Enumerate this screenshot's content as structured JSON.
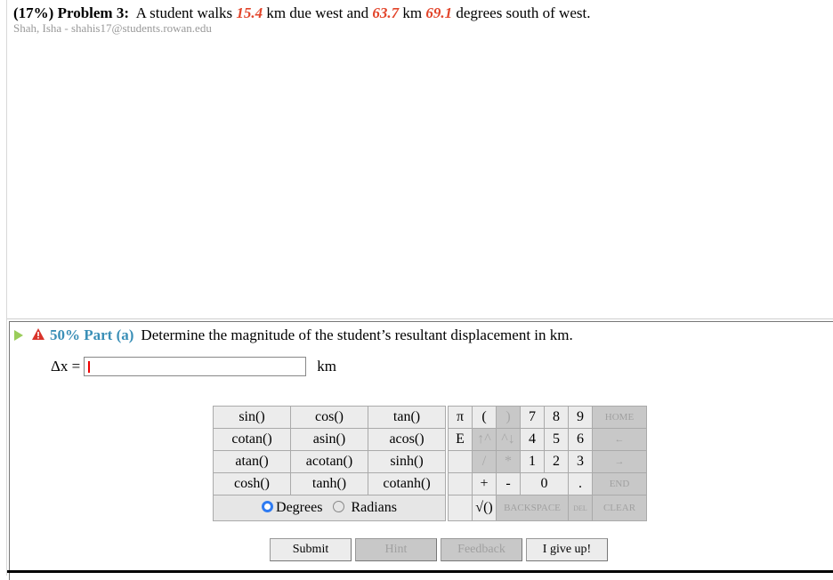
{
  "problem": {
    "percent": "(17%)",
    "label": "Problem 3:",
    "text_1": "A student walks",
    "value_1": "15.4",
    "text_2": "km due west and",
    "value_2": "63.7",
    "text_3": "km",
    "value_3": "69.1",
    "text_4": "degrees south of west.",
    "student": "Shah, Isha - shahis17@students.rowan.edu"
  },
  "part": {
    "percent": "50% Part (a)",
    "question": "Determine the magnitude of the student’s resultant displacement in km.",
    "answer_label": "Δx =",
    "answer_value": "",
    "unit": "km"
  },
  "trig_keys": [
    [
      "sin()",
      "cos()",
      "tan()"
    ],
    [
      "cotan()",
      "asin()",
      "acos()"
    ],
    [
      "atan()",
      "acotan()",
      "sinh()"
    ],
    [
      "cosh()",
      "tanh()",
      "cotanh()"
    ]
  ],
  "angle_mode": {
    "options": [
      "Degrees",
      "Radians"
    ],
    "selected": "Degrees"
  },
  "keypad": {
    "pi": "π",
    "lparen": "(",
    "rparen": ")",
    "k7": "7",
    "k8": "8",
    "k9": "9",
    "home": "HOME",
    "e": "E",
    "up": "↑^",
    "down": "^↓",
    "k4": "4",
    "k5": "5",
    "k6": "6",
    "left": "←",
    "div": "/",
    "mul": "*",
    "k1": "1",
    "k2": "2",
    "k3": "3",
    "right": "→",
    "plus": "+",
    "minus": "-",
    "k0": "0",
    "dot": ".",
    "end": "END",
    "sqrt": "√()",
    "backspace": "BACKSPACE",
    "del": "DEL",
    "clear": "CLEAR"
  },
  "actions": {
    "submit": "Submit",
    "hint": "Hint",
    "feedback": "Feedback",
    "give_up": "I give up!"
  }
}
